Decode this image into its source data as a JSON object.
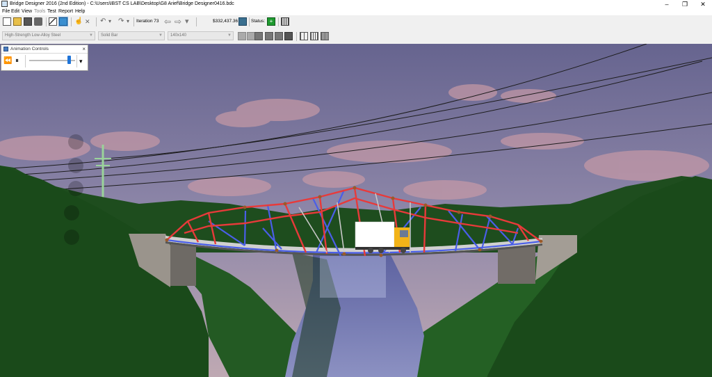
{
  "window": {
    "title": "Bridge Designer 2016 (2nd Edition) - C:\\Users\\IBST CS LAB\\Desktop\\G8 Arief\\Bridge Designer0416.bdc",
    "minimize": "–",
    "maximize": "❐",
    "close": "✕"
  },
  "menu": [
    "File",
    "Edit",
    "View",
    "Tools",
    "Test",
    "Report",
    "Help"
  ],
  "toolbar": {
    "iteration_label": "Iteration 73",
    "cost": "$332,437.36",
    "status_label": "Status:",
    "status_icon_text": "+",
    "undo_glyph": "↶",
    "redo_glyph": "↷",
    "dropdown_glyph": "▾",
    "back_glyph": "⇦",
    "forward_glyph": "⇨",
    "delete_glyph": "✕"
  },
  "member_bar": {
    "material": "High-Strength Low-Alloy Steel",
    "section": "Solid Bar",
    "size": "140x140"
  },
  "animation_controls": {
    "title": "Animation Controls",
    "close": "×",
    "rewind": "⏪",
    "pause": "⏸",
    "menu": "▾",
    "speed_level": 0.9
  },
  "colors": {
    "compression": "#e83a3a",
    "tension": "#4a5ee8",
    "sky_top": "#6e6c98",
    "terrain": "#1b4a1b",
    "water": "#7a80b0",
    "status_green": "#1e9a2f"
  }
}
